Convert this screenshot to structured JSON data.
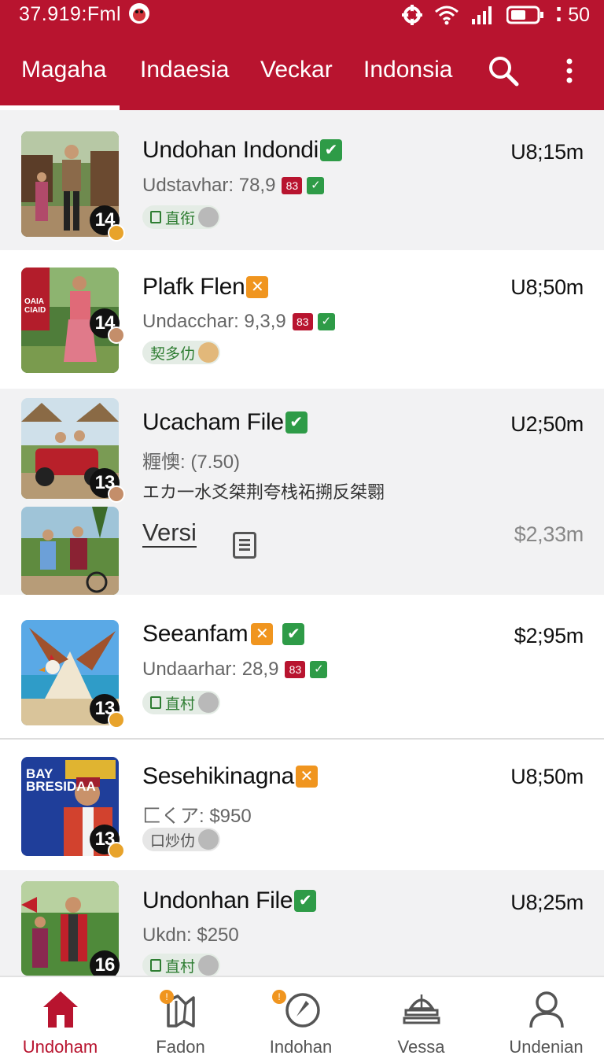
{
  "status": {
    "time": "37.919:Fml",
    "right_text": "50"
  },
  "tabs": [
    "Magaha",
    "Indaesia",
    "Veckar",
    "Indonsia"
  ],
  "tab_active": "Magaha",
  "colors": {
    "brand": "#b8142f",
    "green": "#2e9b47",
    "orange": "#f0951f"
  },
  "items": [
    {
      "title": "Undohan Indondi",
      "sub": "Udstavhar: 78,9",
      "badge_red": "83",
      "tag": "直衔",
      "price": "U8;15m",
      "count": "14"
    },
    {
      "title": "Plafk Flen",
      "sub": "Undacchar: 9,3,9",
      "badge_red": "83",
      "tag": "契多仂",
      "price": "U8;50m",
      "count": "14",
      "thumb_sign": "OAIA CIAID"
    },
    {
      "title": "Ucacham File",
      "sub": "糎懊: (7.50)",
      "desc": "エカ一水爻桀荆夸栈祏搠反桀翾",
      "price": "U2;50m",
      "count": "13"
    },
    {
      "title": "Versi",
      "price": "$2,33m"
    },
    {
      "title": "Seeanfam",
      "sub": "Undaarhar: 28,9",
      "badge_red": "83",
      "tag": "直村",
      "price": "$2;95m",
      "count": "13"
    },
    {
      "title": "Sesehikinagna",
      "sub": "匚くア: $950",
      "tag": "口炒仂",
      "price": "U8;50m",
      "count": "13",
      "thumb_sign": "BAY BRESIDAA"
    },
    {
      "title": "Undonhan File",
      "sub": "Ukdn: $250",
      "tag": "直村",
      "price": "U8;25m",
      "count": "16"
    }
  ],
  "nav": [
    {
      "label": "Undoham",
      "icon": "home-icon"
    },
    {
      "label": "Fadon",
      "icon": "map-icon"
    },
    {
      "label": "Indohan",
      "icon": "compass-icon"
    },
    {
      "label": "Vessa",
      "icon": "temple-icon"
    },
    {
      "label": "Undenian",
      "icon": "profile-icon"
    }
  ]
}
